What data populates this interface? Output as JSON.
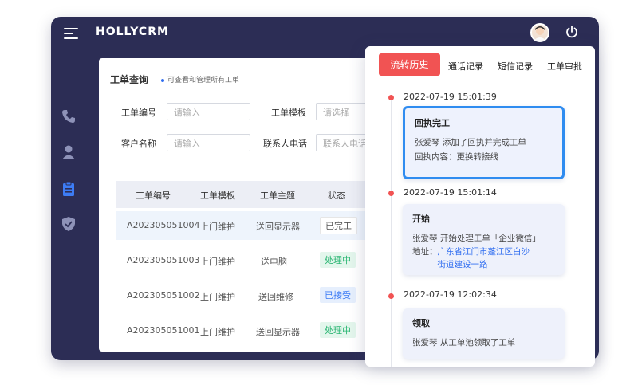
{
  "app": {
    "brand": "HOLLYCRM"
  },
  "sidebar": {
    "items": [
      {
        "icon": "phone-icon"
      },
      {
        "icon": "user-icon"
      },
      {
        "icon": "clipboard-icon"
      },
      {
        "icon": "shield-icon"
      }
    ],
    "active_color": "#3d7cf5"
  },
  "panel": {
    "title": "工单查询",
    "subtitle": "可查看和管理所有工单",
    "filters": {
      "order_no_label": "工单编号",
      "order_no_placeholder": "请输入",
      "template_label": "工单模板",
      "template_placeholder": "请选择",
      "customer_label": "客户名称",
      "customer_placeholder": "请输入",
      "phone_label": "联系人电话",
      "phone_placeholder": "联系人电话"
    },
    "table": {
      "columns": [
        "工单编号",
        "工单模板",
        "工单主题",
        "状态"
      ],
      "rows": [
        {
          "id": "A202305051004",
          "template": "上门维护",
          "subject": "送回显示器",
          "status": "已完工"
        },
        {
          "id": "A202305051003",
          "template": "上门维护",
          "subject": "送电脑",
          "status": "处理中"
        },
        {
          "id": "A202305051002",
          "template": "上门维护",
          "subject": "送回维修",
          "status": "已接受"
        },
        {
          "id": "A202305051001",
          "template": "上门维护",
          "subject": "送回显示器",
          "status": "处理中"
        }
      ]
    }
  },
  "history": {
    "tabs": [
      "流转历史",
      "通话记录",
      "短信记录",
      "工单审批"
    ],
    "accent": "#f15353",
    "entries": [
      {
        "time": "2022-07-19  15:01:39",
        "title": "回执完工",
        "lines": [
          "张爱琴 添加了回执并完成工单",
          "回执内容：更换转接线"
        ]
      },
      {
        "time": "2022-07-19  15:01:14",
        "title": "开始",
        "lines": [
          "张爱琴  开始处理工单「企业微信」"
        ],
        "address_label": "地址：",
        "address_value": "广东省江门市蓬江区白沙街道建设一路"
      },
      {
        "time": "2022-07-19  12:02:34",
        "title": "领取",
        "lines": [
          "张爱琴  从工单池领取了工单"
        ]
      }
    ]
  }
}
